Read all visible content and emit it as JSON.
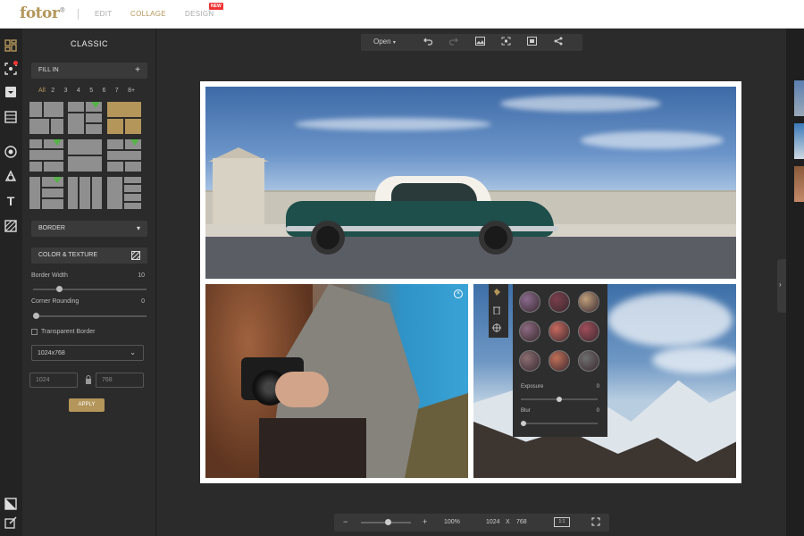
{
  "app": {
    "logo": "fotor",
    "logo_mark": "®"
  },
  "nav": {
    "items": [
      "EDIT",
      "COLLAGE",
      "DESIGN"
    ],
    "active": "COLLAGE",
    "new_badge": "NEW"
  },
  "panel": {
    "title": "CLASSIC",
    "fill_in": {
      "label": "FILL IN",
      "action": "+"
    },
    "counts": [
      "All",
      "2",
      "3",
      "4",
      "5",
      "6",
      "7",
      "8+"
    ],
    "active_count": "All",
    "border": {
      "label": "BORDER",
      "caret": "▾"
    },
    "color_texture": {
      "label": "COLOR & TEXTURE"
    },
    "border_width": {
      "label": "Border Width",
      "value": "10",
      "level": 0.22
    },
    "corner_rounding": {
      "label": "Corner Rounding",
      "value": "0",
      "level": 0.0
    },
    "transparent_border": {
      "label": "Transparent Border",
      "checked": false
    },
    "size_select": {
      "value": "1024x768",
      "caret": "⌄"
    },
    "width_value": "1024",
    "height_value": "768",
    "apply_label": "APPLY"
  },
  "toolbar": {
    "open_label": "Open",
    "open_caret": "▾"
  },
  "popover": {
    "exposure": {
      "label": "Exposure",
      "value": "0",
      "level": 0.5
    },
    "blur": {
      "label": "Blur",
      "value": "0",
      "level": 0.0
    },
    "swatch_colors": [
      "#8a6b8e",
      "#7a3f4b",
      "#c0a07c",
      "#8b6a80",
      "#c86a5e",
      "#a04e5a",
      "#8a6e72",
      "#c07058",
      "#6f6f6f"
    ]
  },
  "bottom": {
    "minus": "−",
    "plus": "+",
    "zoom": "100%",
    "width": "1024",
    "x": "X",
    "height": "768",
    "ratio": "1:1",
    "zoom_level": 0.55
  },
  "right": {
    "handle": "›"
  },
  "colors": {
    "accent": "#b4965a",
    "badge_green": "#57b24a",
    "new_red": "#e33333"
  }
}
